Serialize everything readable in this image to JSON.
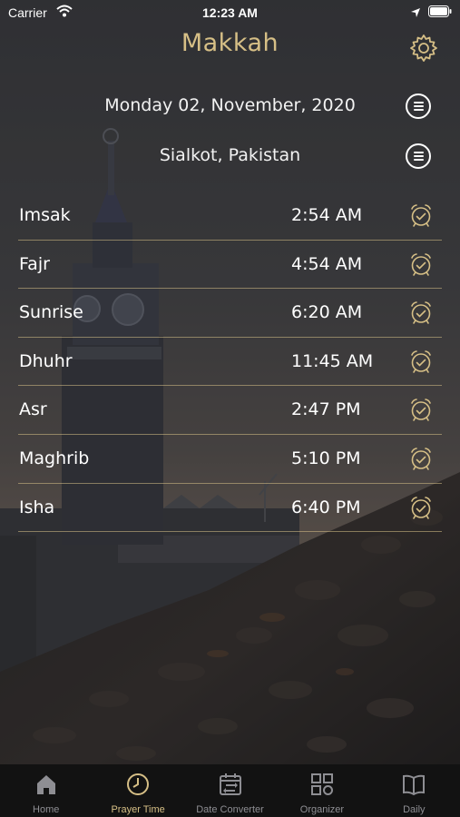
{
  "status_bar": {
    "carrier": "Carrier",
    "time": "12:23 AM",
    "icons": [
      "wifi-icon",
      "location-arrow-icon",
      "battery-icon"
    ]
  },
  "header": {
    "title": "Makkah",
    "settings_icon": "gear-icon"
  },
  "date": {
    "text": "Monday 02, November, 2020",
    "menu_icon": "menu-lines-icon"
  },
  "location": {
    "text": "Sialkot, Pakistan",
    "menu_icon": "menu-lines-icon"
  },
  "prayers": [
    {
      "name": "Imsak",
      "time": "2:54 AM",
      "icon": "alarm-icon"
    },
    {
      "name": "Fajr",
      "time": "4:54 AM",
      "icon": "alarm-icon"
    },
    {
      "name": "Sunrise",
      "time": "6:20 AM",
      "icon": "alarm-icon"
    },
    {
      "name": "Dhuhr",
      "time": "11:45 AM",
      "icon": "alarm-icon"
    },
    {
      "name": "Asr",
      "time": "2:47 PM",
      "icon": "alarm-icon"
    },
    {
      "name": "Maghrib",
      "time": "5:10 PM",
      "icon": "alarm-icon"
    },
    {
      "name": "Isha",
      "time": "6:40 PM",
      "icon": "alarm-icon"
    }
  ],
  "tabs": [
    {
      "label": "Home",
      "icon": "home-icon",
      "active": false
    },
    {
      "label": "Prayer Time",
      "icon": "clock-icon",
      "active": true
    },
    {
      "label": "Date Converter",
      "icon": "calendar-convert-icon",
      "active": false
    },
    {
      "label": "Organizer",
      "icon": "grid-icon",
      "active": false
    },
    {
      "label": "Daily",
      "icon": "book-icon",
      "active": false
    }
  ],
  "colors": {
    "accent": "#d6bf86",
    "tab_bar": "#121212",
    "inactive_tab": "#8e8e93"
  }
}
